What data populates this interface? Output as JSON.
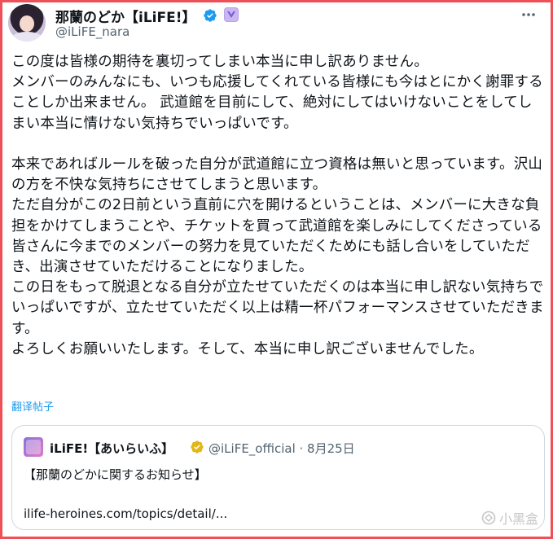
{
  "header": {
    "display_name": "那蘭のどか【iLiFE!】",
    "handle": "@iLiFE_nara"
  },
  "tweet": {
    "text": "この度は皆様の期待を裏切ってしまい本当に申し訳ありません。\nメンバーのみんなにも、いつも応援してくれている皆様にも今はとにかく謝罪することしか出来ません。 武道館を目前にして、絶対にしてはいけないことをしてしまい本当に情けない気持ちでいっぱいです。\n\n本来であればルールを破った自分が武道館に立つ資格は無いと思っています。沢山の方を不快な気持ちにさせてしまうと思います。\nただ自分がこの2日前という直前に穴を開けるということは、メンバーに大きな負担をかけてしまうことや、チケットを買って武道館を楽しみにしてくださっている皆さんに今までのメンバーの努力を見ていただくためにも話し合いをしていただき、出演させていただけることになりました。\nこの日をもって脱退となる自分が立たせていただくのは本当に申し訳ない気持ちでいっぱいですが、立たせていただく以上は精一杯パフォーマンスさせていただきます。\nよろしくお願いいたします。そして、本当に申し訳ございませんでした。",
    "translate_label": "翻译帖子"
  },
  "quote": {
    "name": "iLiFE!【あいらいふ】",
    "handle_date": "@iLiFE_official · 8月25日",
    "title": "【那蘭のどかに関するお知らせ】",
    "link": "ilife-heroines.com/topics/detail/..."
  },
  "watermark": "小黑盒",
  "colors": {
    "frame_border": "#ef4f56",
    "link": "#1d9bf0",
    "verified_blue": "#1d9bf0",
    "verified_gold": "#e2b719",
    "secondary_text": "#536471"
  },
  "icons": {
    "verified": "verified-badge-icon",
    "affiliate": "affiliate-badge-icon",
    "more": "more-icon"
  }
}
